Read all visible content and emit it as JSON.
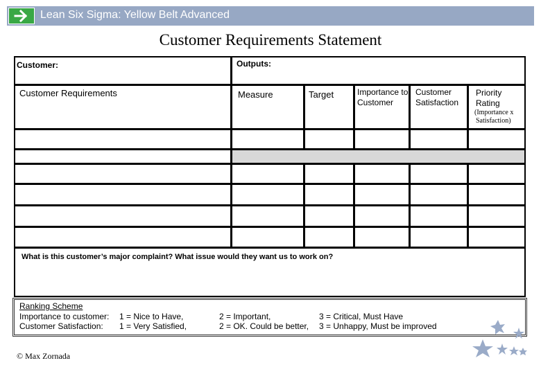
{
  "header": {
    "title": "Lean Six Sigma: Yellow Belt Advanced",
    "logo_icon": "arrow-right-icon",
    "color": "#97a8c4",
    "logo_color": "#39a845"
  },
  "document": {
    "title": "Customer Requirements Statement"
  },
  "form": {
    "customer_label": "Customer:",
    "outputs_label": "Outputs:",
    "columns": {
      "requirements": "Customer Requirements",
      "measure": "Measure",
      "target": "Target",
      "importance_1": "Importance to",
      "importance_2": "Customer",
      "satisfaction_1": "Customer",
      "satisfaction_2": "Satisfaction",
      "priority_1": "Priority",
      "priority_2": "Rating",
      "priority_note_1": "(Importance x",
      "priority_note_2": "Satisfaction)"
    },
    "blank_rows": 6,
    "complaint_question": "What is this customer’s major complaint? What issue would they want us to work on?"
  },
  "ranking": {
    "title": "Ranking Scheme",
    "importance_label": "Importance to customer:",
    "satisfaction_label": "Customer Satisfaction:",
    "importance_1": "1 = Nice to Have,",
    "importance_2": "2 = Important,",
    "importance_3": "3 = Critical, Must Have",
    "satisfaction_1": "1 = Very Satisfied,",
    "satisfaction_2": "2 = OK. Could be better,",
    "satisfaction_3": "3 = Unhappy, Must be improved"
  },
  "footer": {
    "copyright": "© Max Zornada",
    "decoration_icon": "stars-icon",
    "star_color": "#9aabc8"
  }
}
